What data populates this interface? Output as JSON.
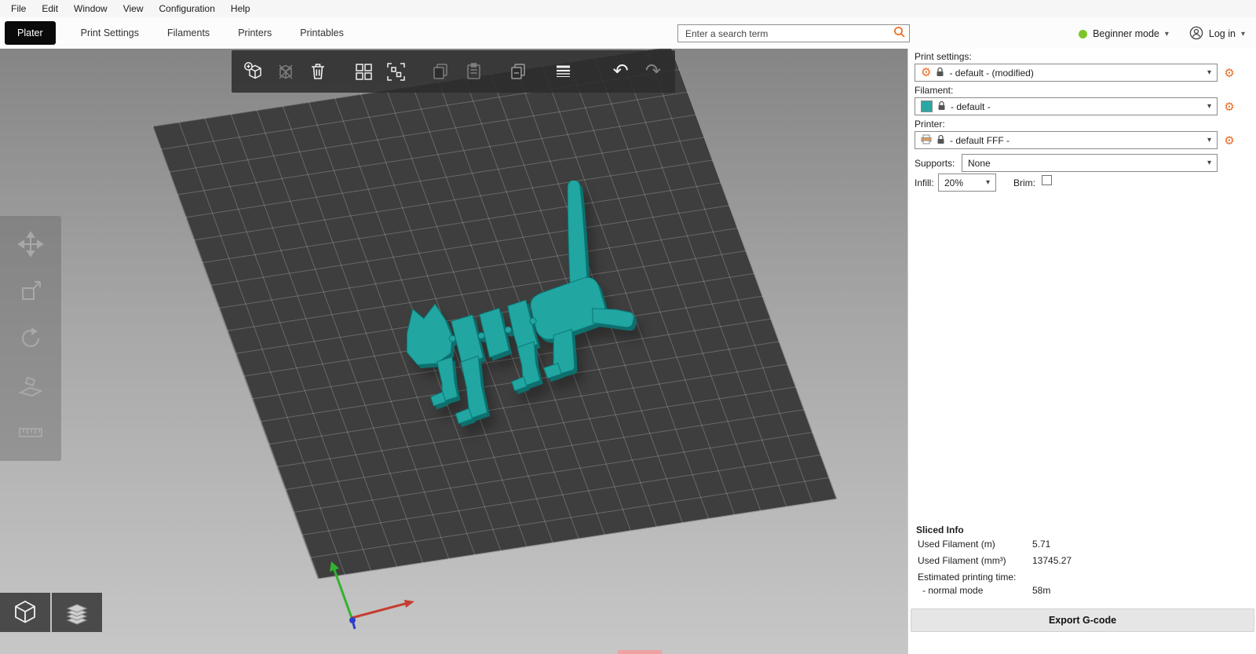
{
  "menu": {
    "items": [
      "File",
      "Edit",
      "Window",
      "View",
      "Configuration",
      "Help"
    ]
  },
  "tabs": [
    "Plater",
    "Print Settings",
    "Filaments",
    "Printers",
    "Printables"
  ],
  "search": {
    "placeholder": "Enter a search term"
  },
  "session": {
    "mode_label": "Beginner mode",
    "login_label": "Log in"
  },
  "icons": {
    "gear": "⚙",
    "caret": "▾",
    "undo": "↶",
    "redo": "↷"
  },
  "toolbar": {
    "icons": [
      "add",
      "delete",
      "delete-all",
      "arrange",
      "arrange-selection",
      "copy",
      "paste",
      "instances",
      "variable-layer-height",
      "undo",
      "redo"
    ]
  },
  "side_toolbar": {
    "icons": [
      "move",
      "scale",
      "rotate",
      "place-on-face",
      "measure"
    ]
  },
  "view_toggle": {
    "icons": [
      "3d-view",
      "layers-view"
    ]
  },
  "panel": {
    "print_settings": {
      "label": "Print settings:",
      "value": "- default - (modified)"
    },
    "filament": {
      "label": "Filament:",
      "value": "- default -",
      "color": "#2aa7a4"
    },
    "printer": {
      "label": "Printer:",
      "value": "- default FFF -"
    },
    "supports": {
      "label": "Supports:",
      "value": "None"
    },
    "infill": {
      "label": "Infill:",
      "value": "20%"
    },
    "brim": {
      "label": "Brim:",
      "checked": false
    },
    "sliced_info": {
      "title": "Sliced Info",
      "rows": [
        {
          "label": "Used Filament (m)",
          "value": "5.71"
        },
        {
          "label": "Used Filament (mm³)",
          "value": "13745.27"
        },
        {
          "label": "Estimated printing time:",
          "value": ""
        },
        {
          "label": "- normal mode",
          "value": "58m"
        }
      ]
    },
    "export_button": "Export G-code"
  },
  "colors": {
    "accent_orange": "#ed6b21",
    "beginner_green": "#7dc42a",
    "model_teal": "#21a6a2",
    "bed_gray": "#3e3e3e",
    "axis_x_red": "#c63c30",
    "axis_y_green": "#33b22e",
    "axis_z_blue": "#2e3ecc"
  }
}
